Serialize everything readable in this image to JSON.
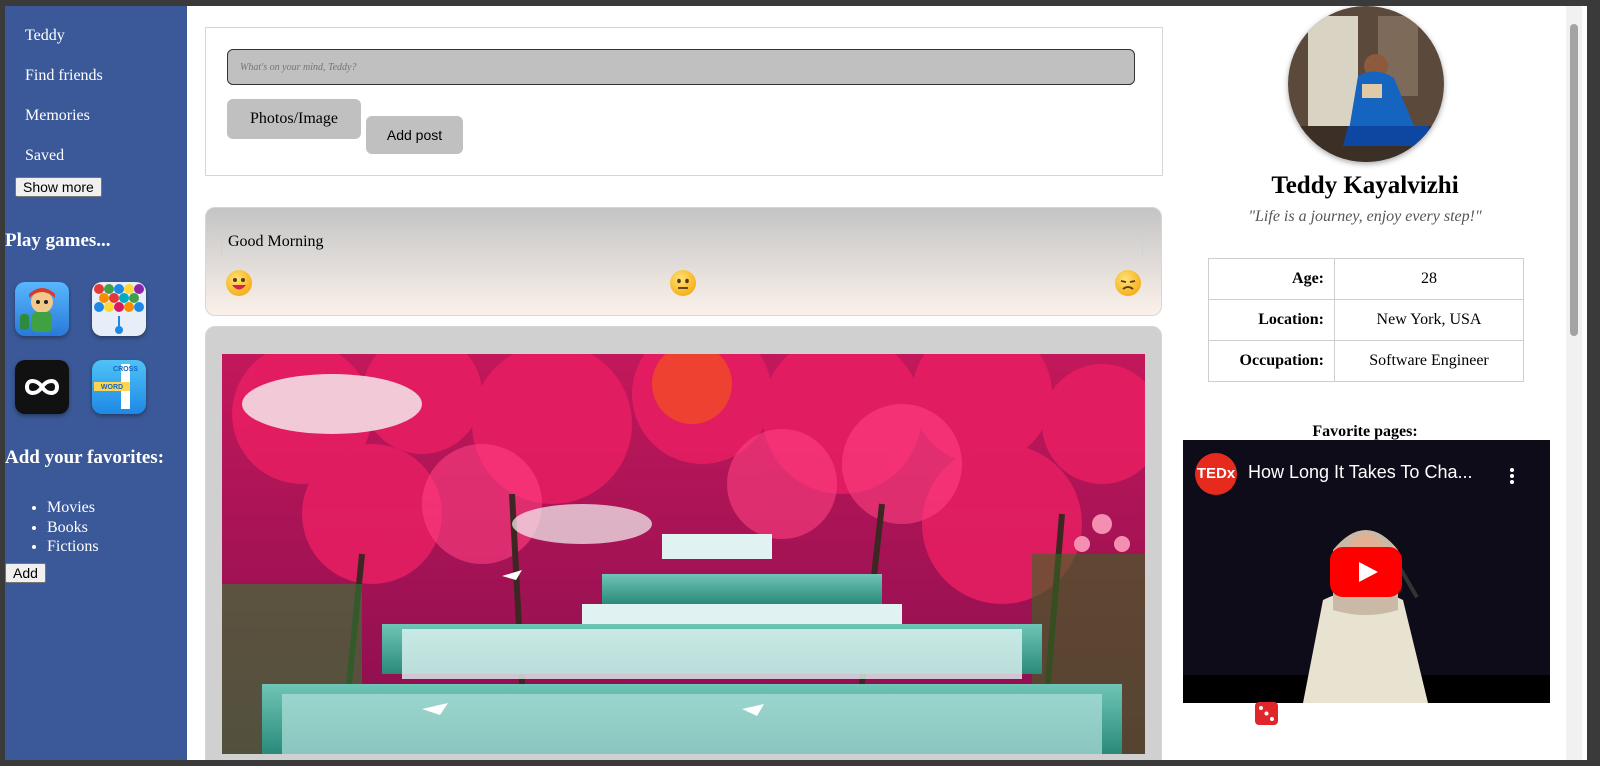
{
  "sidebar": {
    "nav": [
      "Teddy",
      "Find friends",
      "Memories",
      "Saved"
    ],
    "show_more_label": "Show more",
    "games_heading": "Play games...",
    "games": [
      {
        "icon": "runner-game-icon"
      },
      {
        "icon": "bubble-shooter-icon"
      },
      {
        "icon": "infinity-game-icon"
      },
      {
        "icon": "word-crossword-icon",
        "text_lines": [
          "CROSS",
          "WORD"
        ]
      }
    ],
    "favorites_heading": "Add your favorites:",
    "favorites": [
      "Movies",
      "Books",
      "Fictions"
    ],
    "add_label": "Add"
  },
  "composer": {
    "placeholder": "What's on your mind, Teddy?",
    "photo_label": "Photos/Image",
    "add_post_label": "Add post"
  },
  "post": {
    "text": "Good Morning",
    "reactions": [
      "grinning-face-icon",
      "neutral-face-icon",
      "sad-face-icon"
    ]
  },
  "image_post": {
    "image": "pink-forest-waterfall-image"
  },
  "profile": {
    "name": "Teddy Kayalvizhi",
    "quote": "\"Life is a journey, enjoy every step!\"",
    "info": [
      {
        "key": "Age:",
        "value": "28"
      },
      {
        "key": "Location:",
        "value": "New York, USA"
      },
      {
        "key": "Occupation:",
        "value": "Software Engineer"
      }
    ],
    "favorite_pages_label": "Favorite pages:",
    "video": {
      "channel_logo": "TEDx",
      "title": "How Long It Takes To Cha..."
    }
  },
  "colors": {
    "sidebar_bg": "#3b5998",
    "button_gray": "#c0c0c0",
    "youtube_red": "#ff0000",
    "ted_red": "#e62b1e"
  }
}
